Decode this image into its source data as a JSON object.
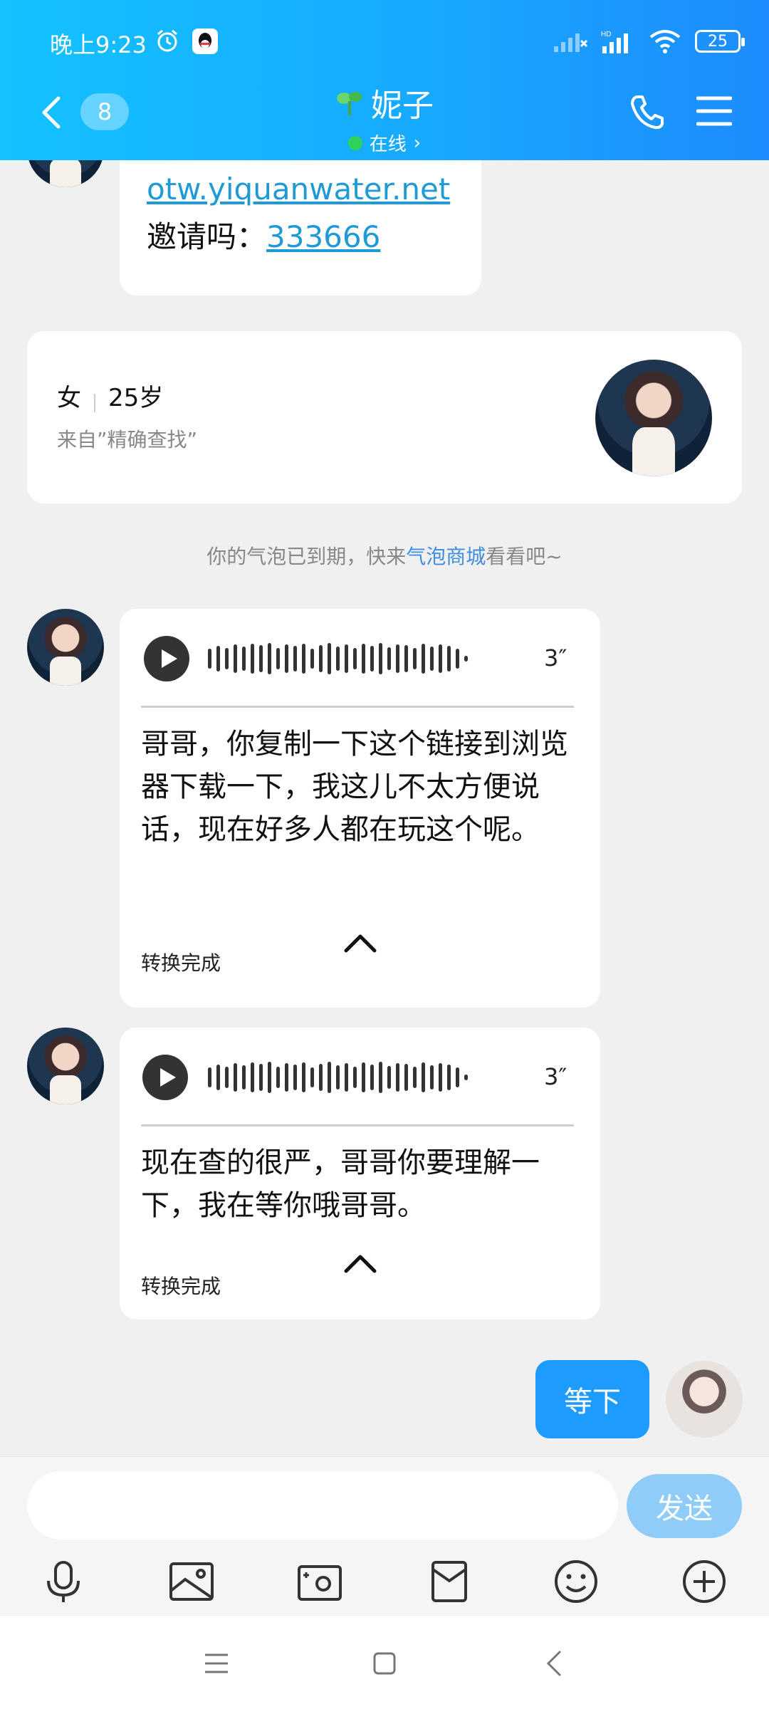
{
  "status_bar": {
    "time": "晚上9:23",
    "battery": "25"
  },
  "header": {
    "unread_count": "8",
    "contact_name": "妮子",
    "online_status": "在线",
    "accent_color": "#17a9ff"
  },
  "messages": {
    "partial_link": "otw.yiquanwater.net",
    "invite_label": "邀请吗：",
    "invite_code": "333666",
    "profile_card": {
      "gender": "女",
      "age": "25岁",
      "source": "来自”精确查找”"
    },
    "system_note_prefix": "你的气泡已到期，快来",
    "system_note_link": "气泡商城",
    "system_note_suffix": "看看吧~",
    "voice_1": {
      "duration": "3″",
      "transcript": "哥哥，你复制一下这个链接到浏览器下载一下，我这儿不太方便说话，现在好多人都在玩这个呢。",
      "status": "转换完成"
    },
    "voice_2": {
      "duration": "3″",
      "transcript": "现在查的很严，哥哥你要理解一下，我在等你哦哥哥。",
      "status": "转换完成"
    },
    "my_message": "等下"
  },
  "input_bar": {
    "send_label": "发送",
    "tools": [
      "microphone-icon",
      "image-icon",
      "camera-icon",
      "red-packet-icon",
      "emoji-icon",
      "plus-icon"
    ]
  }
}
